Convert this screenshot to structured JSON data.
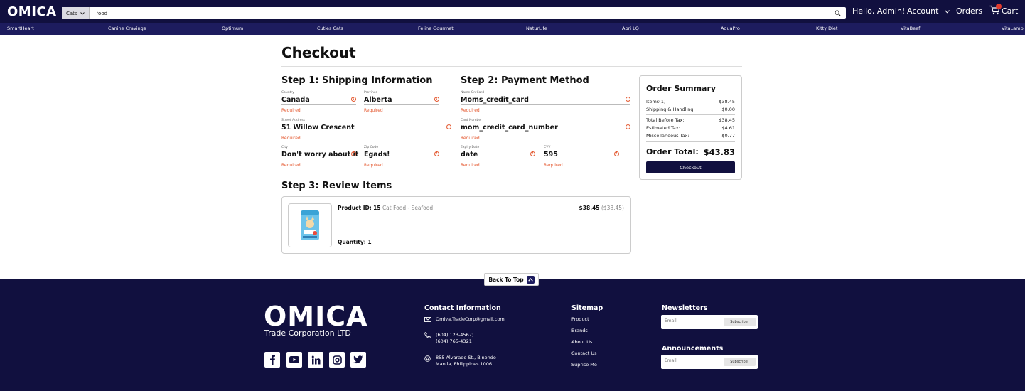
{
  "header": {
    "logo": "OMICA",
    "category": "Cats",
    "search_value": "food",
    "greeting": "Hello, Admin!",
    "account": "Account",
    "orders": "Orders",
    "cart": "Cart"
  },
  "brands": [
    "SmartHeart",
    "Canine Cravings",
    "Optimum",
    "Cuties Cats",
    "Feline Gourmet",
    "NaturLife",
    "Apri LQ",
    "AquaPro",
    "Kitty Diet",
    "VitaBeef",
    "VitaLamb"
  ],
  "checkout": {
    "title": "Checkout",
    "step1": "Step 1: Shipping Information",
    "step2": "Step 2: Payment Method",
    "step3": "Step 3: Review Items",
    "required": "Required",
    "country_label": "Country",
    "country": "Canada",
    "province_label": "Province",
    "province": "Alberta",
    "street_label": "Street Address",
    "street": "51 Willow Crescent",
    "city_label": "City",
    "city": "Don't worry about it",
    "zip_label": "Zip Code",
    "zip": "Egads!",
    "name_label": "Name On Card",
    "name": "Moms_credit_card",
    "card_label": "Card Number",
    "card": "mom_credit_card_number",
    "expiry_label": "Expiry Date",
    "expiry": "date",
    "cvv_label": "CVV",
    "cvv": "595"
  },
  "summary": {
    "title": "Order Summary",
    "items_label": "Items(1)",
    "items": "$38.45",
    "shipping_label": "Shipping & Handling:",
    "shipping": "$0.00",
    "before_tax_label": "Total Before Tax:",
    "before_tax": "$38.45",
    "est_tax_label": "Estimated Tax:",
    "est_tax": "$4.61",
    "misc_label": "Miscellaneous Tax:",
    "misc": "$0.77",
    "total_label": "Order Total:",
    "total": "$43.83",
    "button": "Checkout"
  },
  "review": {
    "pid_label": "Product ID:",
    "pid": "15",
    "desc": "Cat Food - Seafood",
    "price": "$38.45",
    "price_orig": "($38.45)",
    "qty_label": "Quantity:",
    "qty": "1"
  },
  "back_to_top": "Back To Top",
  "footer": {
    "logo": "OMICA",
    "sub": "Trade Corporation LTD",
    "contact_h": "Contact Information",
    "email": "Omiva.TradeCorp@gmail.com",
    "phone1": "(604) 123-4567;",
    "phone2": "(604) 765-4321",
    "addr1": "855 Alvarado St., Binondo",
    "addr2": "Manila, Philippines 1006",
    "sitemap_h": "Sitemap",
    "sitemap": [
      "Product",
      "Brands",
      "About Us",
      "Contact Us",
      "Suprise Me"
    ],
    "newsletters_h": "Newsletters",
    "announcements_h": "Announcements",
    "email_placeholder": "Email",
    "subscribe": "Subscribe!"
  },
  "colors": {
    "navy": "#11103f",
    "brandbar": "#1d1c5e",
    "error": "#e4572e"
  }
}
